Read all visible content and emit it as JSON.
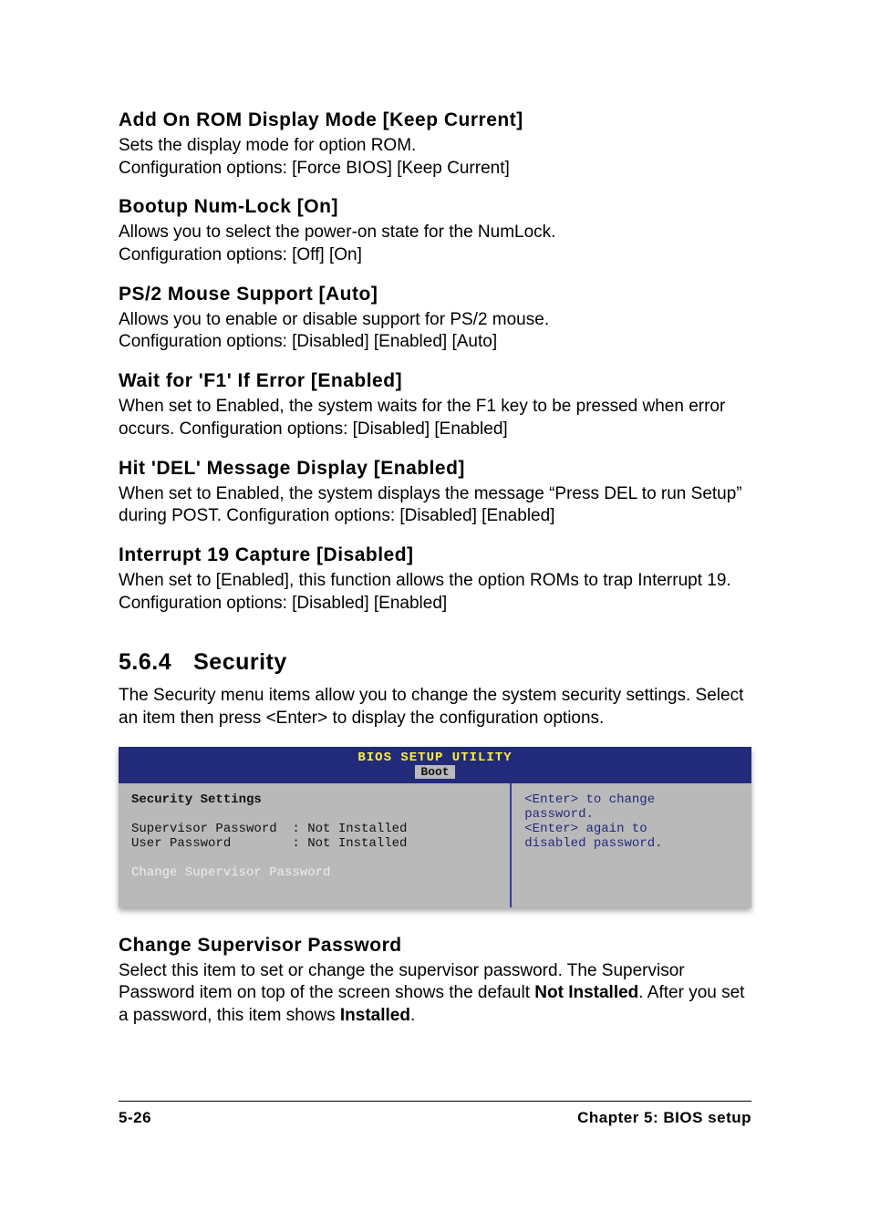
{
  "sections": {
    "s1": {
      "title": "Add On ROM Display Mode [Keep Current]",
      "body": "Sets the display mode for option ROM.\nConfiguration options: [Force BIOS] [Keep Current]"
    },
    "s2": {
      "title": "Bootup Num-Lock [On]",
      "body": "Allows you to select the power-on state for the NumLock.\nConfiguration options: [Off] [On]"
    },
    "s3": {
      "title": "PS/2 Mouse Support [Auto]",
      "body": "Allows you to enable or disable support for PS/2 mouse.\nConfiguration options: [Disabled] [Enabled] [Auto]"
    },
    "s4": {
      "title": "Wait for 'F1' If Error [Enabled]",
      "body": "When set to Enabled, the system waits for the F1 key to be pressed when error occurs. Configuration options: [Disabled] [Enabled]"
    },
    "s5": {
      "title": "Hit 'DEL' Message Display [Enabled]",
      "body": "When set to Enabled, the system displays the message “Press DEL to run Setup” during POST. Configuration options: [Disabled] [Enabled]"
    },
    "s6": {
      "title": "Interrupt 19 Capture [Disabled]",
      "body": "When set to [Enabled], this function allows the option ROMs to trap Interrupt 19. Configuration options: [Disabled] [Enabled]"
    }
  },
  "subsection": {
    "number": "5.6.4",
    "title": "Security",
    "intro": "The Security menu items allow you to change the system security settings. Select an item then press <Enter> to display the configuration options."
  },
  "bios": {
    "header": "BIOS SETUP UTILITY",
    "tab": "Boot",
    "left": {
      "title": "Security Settings",
      "rows": [
        "Supervisor Password  : Not Installed",
        "User Password        : Not Installed"
      ],
      "selected": "Change Supervisor Password"
    },
    "right": {
      "lines": [
        "<Enter> to change",
        "password.",
        "<Enter> again to",
        "disabled password."
      ]
    }
  },
  "after_bios": {
    "title": "Change Supervisor Password",
    "body_pre": "Select this item to set or change the supervisor password. The Supervisor Password item on top of the screen shows the default ",
    "body_bold1": "Not Installed",
    "body_mid": ". After you set a password, this item shows ",
    "body_bold2": "Installed",
    "body_post": "."
  },
  "footer": {
    "left": "5-26",
    "right": "Chapter 5: BIOS setup"
  }
}
